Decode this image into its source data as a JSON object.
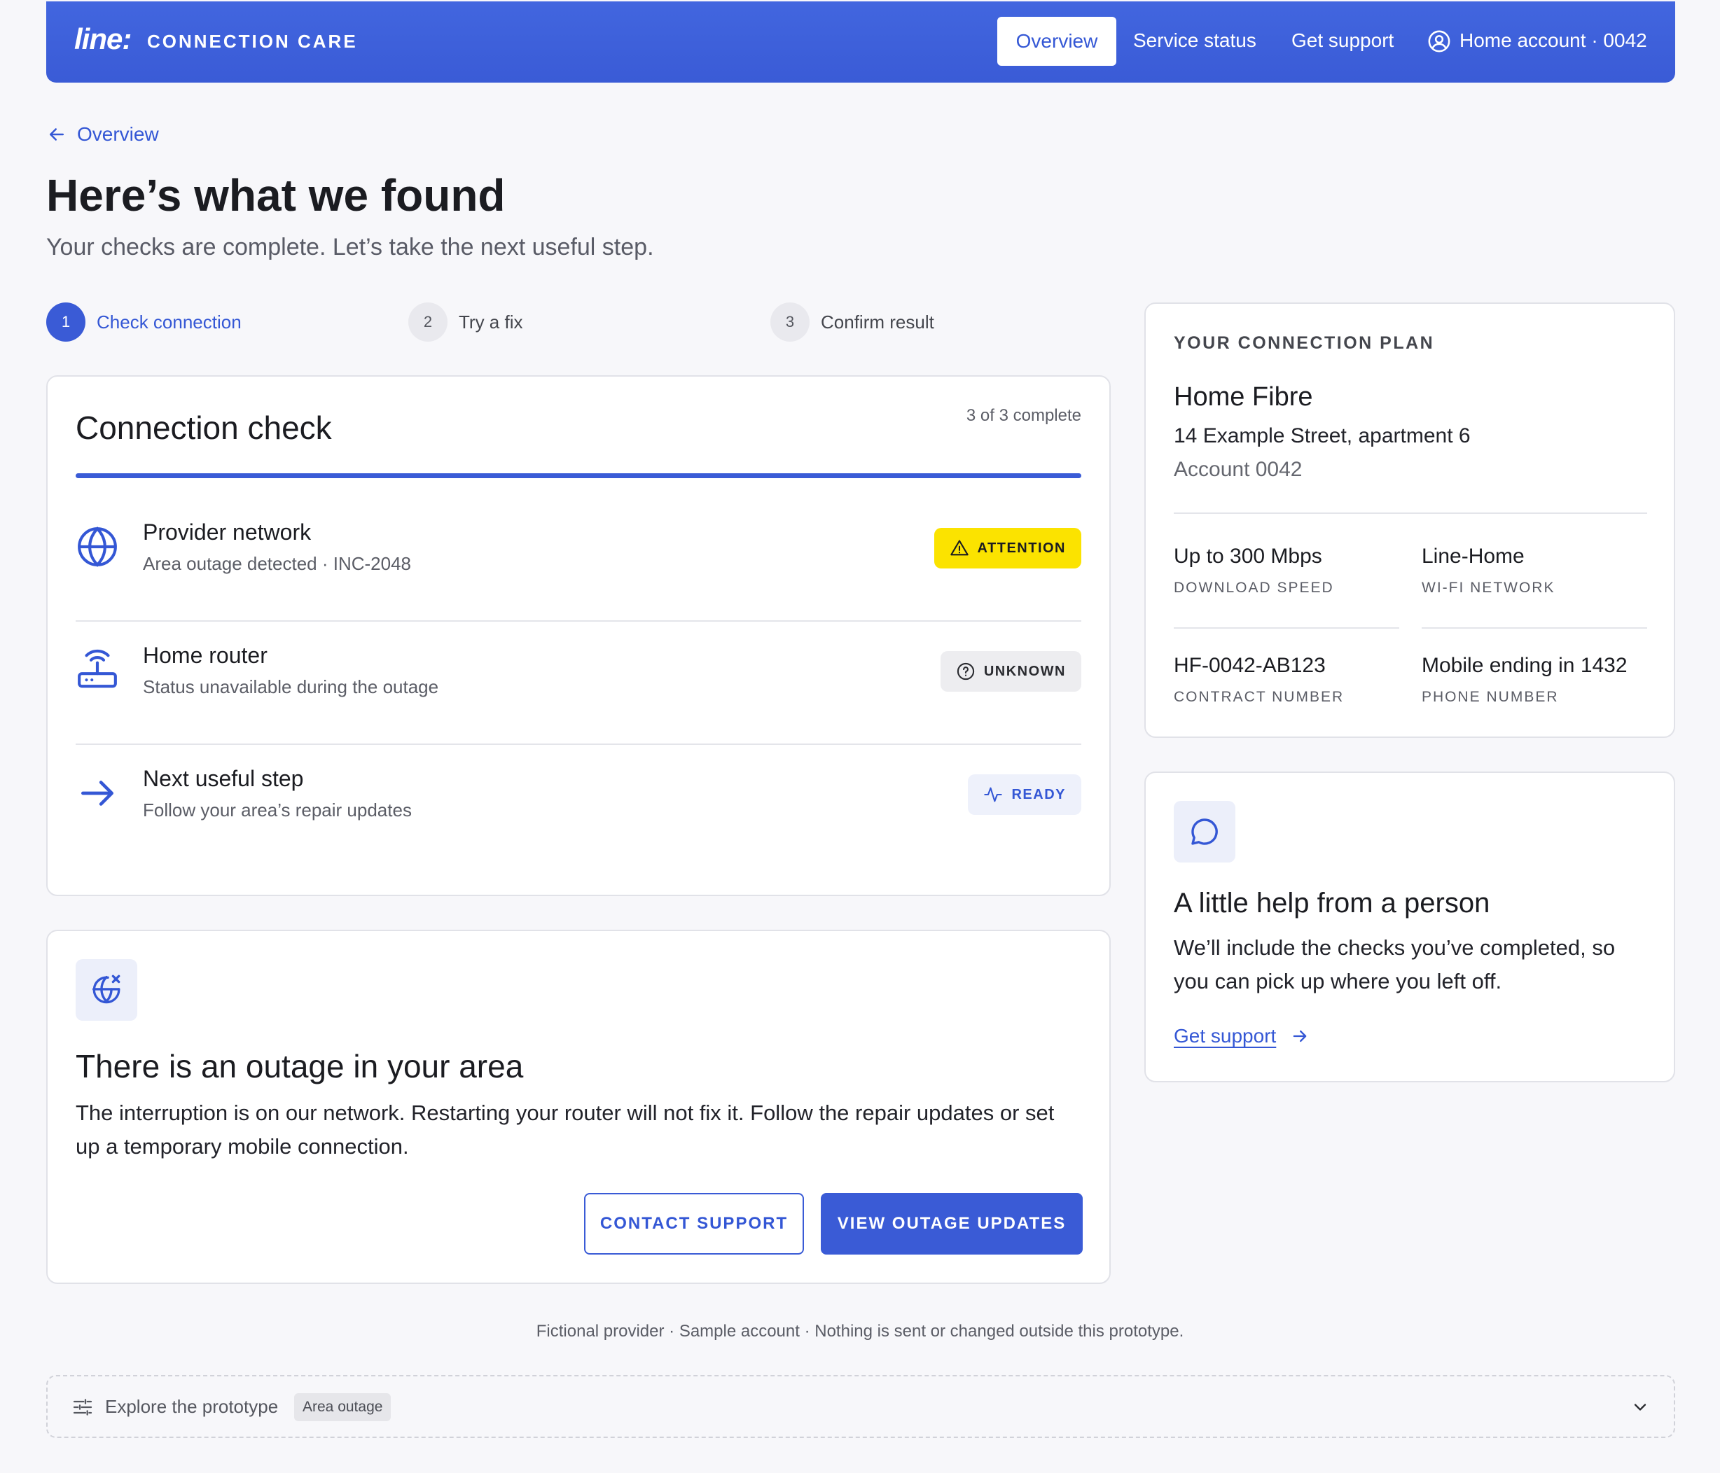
{
  "header": {
    "logo": "line:",
    "brand": "CONNECTION CARE",
    "nav": [
      {
        "label": "Overview",
        "active": true
      },
      {
        "label": "Service status",
        "active": false
      },
      {
        "label": "Get support",
        "active": false
      }
    ],
    "account": "Home account · 0042"
  },
  "back_link": "Overview",
  "page": {
    "title": "Here’s what we found",
    "subtitle": "Your checks are complete. Let’s take the next useful step."
  },
  "stepper": [
    {
      "num": "1",
      "label": "Check connection",
      "active": true
    },
    {
      "num": "2",
      "label": "Try a fix",
      "active": false
    },
    {
      "num": "3",
      "label": "Confirm result",
      "active": false
    }
  ],
  "connection_check": {
    "title": "Connection check",
    "progress_text": "3 of 3 complete",
    "progress_fraction": 1.0,
    "rows": [
      {
        "icon": "globe-icon",
        "title": "Provider network",
        "subtitle": "Area outage detected · INC-2048",
        "badge": "ATTENTION",
        "badge_icon": "warning-icon"
      },
      {
        "icon": "router-icon",
        "title": "Home router",
        "subtitle": "Status unavailable during the outage",
        "badge": "UNKNOWN",
        "badge_icon": "question-icon"
      },
      {
        "icon": "arrow-right-icon",
        "title": "Next useful step",
        "subtitle": "Follow your area’s repair updates",
        "badge": "READY",
        "badge_icon": "pulse-icon"
      }
    ]
  },
  "outage": {
    "icon": "globe-x-icon",
    "title": "There is an outage in your area",
    "body": "The interruption is on our network. Restarting your router will not fix it. Follow the repair updates or set up a temporary mobile connection.",
    "secondary_button": "CONTACT SUPPORT",
    "primary_button": "VIEW OUTAGE UPDATES"
  },
  "plan": {
    "eyebrow": "YOUR CONNECTION PLAN",
    "name": "Home Fibre",
    "address": "14 Example Street, apartment 6",
    "account": "Account 0042",
    "details": [
      {
        "value": "Up to 300 Mbps",
        "key": "DOWNLOAD SPEED"
      },
      {
        "value": "Line-Home",
        "key": "WI-FI NETWORK"
      },
      {
        "value": "HF-0042-AB123",
        "key": "CONTRACT NUMBER"
      },
      {
        "value": "Mobile ending in 1432",
        "key": "PHONE NUMBER"
      }
    ]
  },
  "help": {
    "icon": "chat-icon",
    "title": "A little help from a person",
    "body": "We’ll include the checks you’ve completed, so you can pick up where you left off.",
    "link": "Get support"
  },
  "footer_note": "Fictional provider · Sample account · Nothing is sent or changed outside this prototype.",
  "explore": {
    "label": "Explore the prototype",
    "tag": "Area outage"
  },
  "colors": {
    "accent": "#3a5bd6",
    "attention": "#fbe300",
    "background": "#f7f7fa"
  }
}
